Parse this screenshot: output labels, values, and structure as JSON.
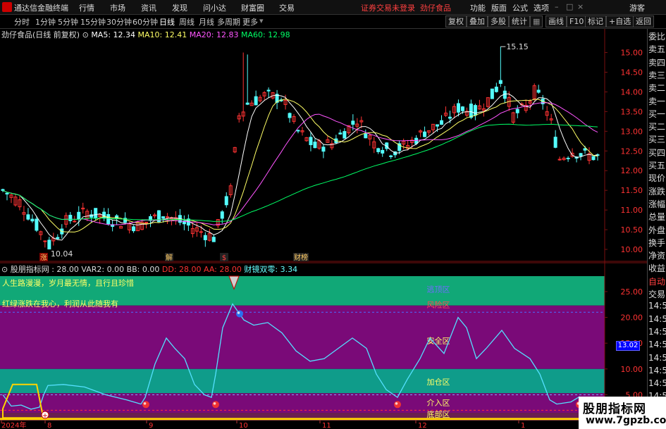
{
  "app": {
    "title": "通达信金融终端",
    "menu": [
      "行情",
      "市场",
      "资讯",
      "发现",
      "问小达",
      "财富圈",
      "交易"
    ],
    "status": "证券交易未登录",
    "stock_name_top": "劲仔食品",
    "right_menu": [
      "功能",
      "版面",
      "公式",
      "选项"
    ],
    "guest": "游客"
  },
  "periods": [
    "分时",
    "1分钟",
    "5分钟",
    "15分钟",
    "30分钟",
    "60分钟",
    "日线",
    "周线",
    "月线",
    "多周期",
    "更多"
  ],
  "active_period": "日线",
  "tools": [
    "复权",
    "叠加",
    "多股",
    "统计",
    "画线",
    "F10",
    "标记",
    "+自选",
    "返回"
  ],
  "main_chart": {
    "title": "劲仔食品(日线 前复权)",
    "ma_labels": [
      {
        "text": "MA5: 12.34",
        "color": "#ffffff"
      },
      {
        "text": "MA10: 12.41",
        "color": "#ffff66"
      },
      {
        "text": "MA20: 12.83",
        "color": "#ff55ff"
      },
      {
        "text": "MA60: 12.98",
        "color": "#00ff66"
      }
    ],
    "y_ticks": [
      "15.00",
      "14.50",
      "14.00",
      "13.50",
      "13.00",
      "12.50",
      "12.00",
      "11.50",
      "11.00",
      "10.50",
      "10.00"
    ],
    "high_label": "15.15",
    "low_label": "10.04",
    "markers": [
      "涨",
      "解",
      "$",
      "财榜"
    ]
  },
  "indicator": {
    "title": "股朋指标网 : 28.00  VAR2: 0.00  BB: 0.00",
    "dd": "DD: 28.00",
    "aa": "AA: 28.00",
    "extra": "财镜双零: 3.34",
    "y_ticks": [
      "25.00",
      "20.00",
      "15.00",
      "10.00",
      "5.00"
    ],
    "zones": [
      "逃顶区",
      "风险区",
      "安全区",
      "加仓区",
      "介入区",
      "底部区"
    ],
    "slogan1": "人生路漫漫，岁月最无情，且行且珍惜",
    "slogan2": "红绿涨跌在我心，利润从此随我有"
  },
  "x_labels": [
    "2024年",
    "8",
    "9",
    "10",
    "11",
    "12",
    "1"
  ],
  "right_quote_labels": [
    "委比",
    "卖五",
    "卖四",
    "卖三",
    "卖二",
    "卖一",
    "买一",
    "买二",
    "买三",
    "买四",
    "买五",
    "现价",
    "涨跌",
    "涨幅",
    "总量",
    "外盘",
    "换手",
    "净资",
    "收益",
    "自动",
    "交易",
    "14:56",
    "14:56",
    "14:56",
    "14:56",
    "14:56",
    "14:56",
    "14:56",
    "14:56",
    "14:56",
    "14:56"
  ],
  "price_tag": "13.02",
  "watermark": {
    "line1": "股朋指标网",
    "line2": "www.7gpzb.com"
  },
  "colors": {
    "up": "#ff3333",
    "down": "#54ffff",
    "zone_green": "#11a877",
    "zone_purple": "#7a0a78",
    "zone_teal": "#0f9c8a"
  }
}
